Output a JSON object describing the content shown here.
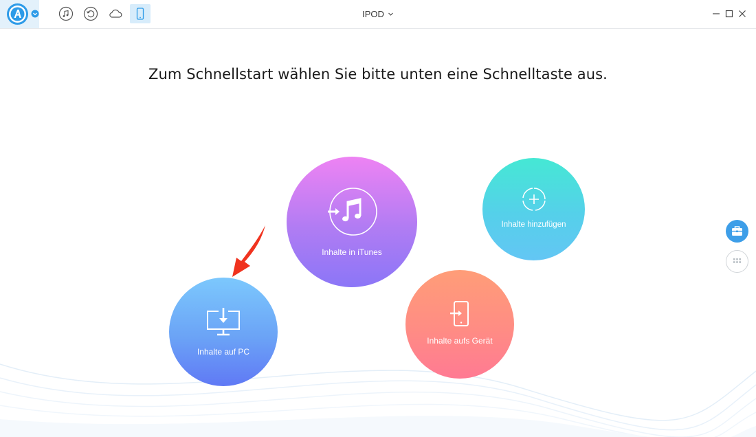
{
  "titlebar": {
    "device_name": "IPOD",
    "logo_letter": "A",
    "tool_icons": [
      "music-icon",
      "restore-icon",
      "cloud-icon",
      "device-icon"
    ],
    "window_controls": [
      "minimize-icon",
      "maximize-icon",
      "close-icon"
    ]
  },
  "main": {
    "heading": "Zum Schnellstart wählen Sie bitte unten eine Schnelltaste aus.",
    "quick_buttons": [
      {
        "label": "Inhalte in iTunes",
        "icon": "to-itunes-icon",
        "color_top": "#ee83f3",
        "color_bottom": "#8b76f7"
      },
      {
        "label": "Inhalte hinzufügen",
        "icon": "add-icon",
        "color_top": "#45e8d4",
        "color_bottom": "#63c6f4"
      },
      {
        "label": "Inhalte auf PC",
        "icon": "to-pc-icon",
        "color_top": "#7cc8fd",
        "color_bottom": "#6079f5"
      },
      {
        "label": "Inhalte aufs Gerät",
        "icon": "to-device-icon",
        "color_top": "#ff9d78",
        "color_bottom": "#ff7a93"
      }
    ]
  },
  "sidebar_right": {
    "buttons": [
      "toolbox-icon",
      "grid-icon"
    ]
  },
  "colors": {
    "accent": "#2d9be8",
    "annotation_arrow": "#f0331f"
  }
}
